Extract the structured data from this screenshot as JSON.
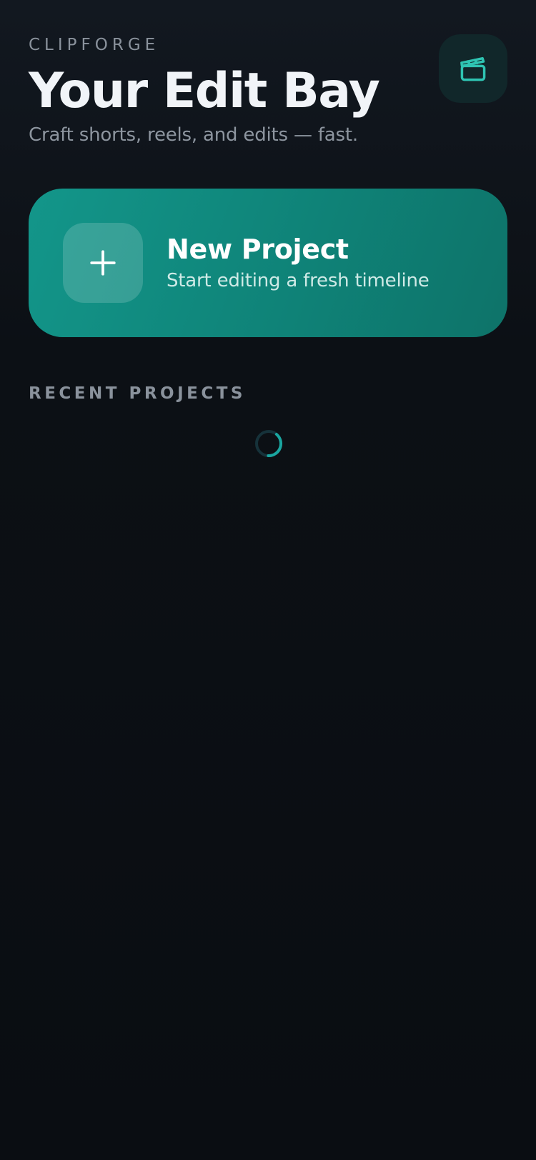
{
  "header": {
    "brand": "CLIPFORGE",
    "title": "Your Edit Bay",
    "subtitle": "Craft shorts, reels, and edits — fast.",
    "icon": "clapperboard-icon"
  },
  "new_project": {
    "title": "New Project",
    "subtitle": "Start editing a fresh timeline",
    "icon": "plus-icon"
  },
  "recent": {
    "section_title": "RECENT PROJECTS",
    "state": "loading"
  },
  "colors": {
    "accent": "#13968a",
    "accent_light": "#2fc4b2",
    "background": "#0a0d12",
    "text_primary": "#f1f4f8",
    "text_muted": "#8a929c"
  }
}
